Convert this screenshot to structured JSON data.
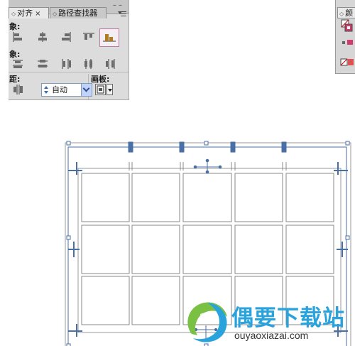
{
  "align_panel": {
    "tabs": [
      {
        "label": "对齐",
        "close": "×"
      },
      {
        "label": "路径查找器"
      }
    ],
    "collapse_symbol": "– –",
    "sections": {
      "align_objects_label": "象:",
      "distribute_objects_label": "象:",
      "distribute_spacing_label": "距:",
      "align_to_label": "画板:"
    },
    "spacing_value": "自动"
  },
  "color_panel": {
    "tab_label": "颜"
  },
  "watermark": {
    "title": "偶要下载站",
    "url": "ouyaoxiazai.com"
  },
  "colors": {
    "panel_bg": "#dcdcdc",
    "selected_border": "#c07aa3",
    "handle_blue": "#4a6fa5",
    "grid_gray": "#9a9a9a",
    "watermark_blue": "#2aa3dd",
    "watermark_green": "#7ac143"
  },
  "table": {
    "rows": 3,
    "columns": 5
  }
}
